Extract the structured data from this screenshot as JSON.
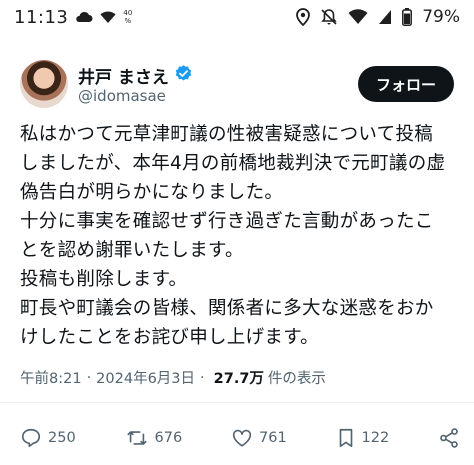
{
  "status_bar": {
    "time": "11:13",
    "net_speed": "40",
    "net_unit": "%",
    "battery": "79%"
  },
  "tweet": {
    "author_name": "井戸 まさえ",
    "author_handle": "@idomasae",
    "follow_label": "フォロー",
    "lines": [
      "私はかつて元草津町議の性被害疑惑について投稿",
      "しましたが、本年4月の前橋地裁判決で元町議の虚",
      "偽告白が明らかになりました。",
      "十分に事実を確認せず行き過ぎた言動があったこ",
      "とを認め謝罪いたします。",
      "投稿も削除します。",
      "町長や町議会の皆様、関係者に多大な迷惑をおか",
      "けしたことをお詫び申し上げます。"
    ],
    "time": "午前8:21",
    "date": "2024年6月3日",
    "views_count": "27.7万",
    "views_label": "件の表示"
  },
  "actions": {
    "replies": "250",
    "reposts": "676",
    "likes": "761",
    "bookmarks": "122"
  },
  "colors": {
    "verified": "#1d9bf0",
    "follow_bg": "#0f1419",
    "secondary_text": "#536471"
  },
  "icons": [
    "cloud-icon",
    "wifi-icon",
    "location-icon",
    "mute-icon",
    "signal-icon",
    "battery-icon",
    "verified-badge-icon",
    "reply-icon",
    "repost-icon",
    "like-icon",
    "bookmark-icon",
    "share-icon"
  ]
}
